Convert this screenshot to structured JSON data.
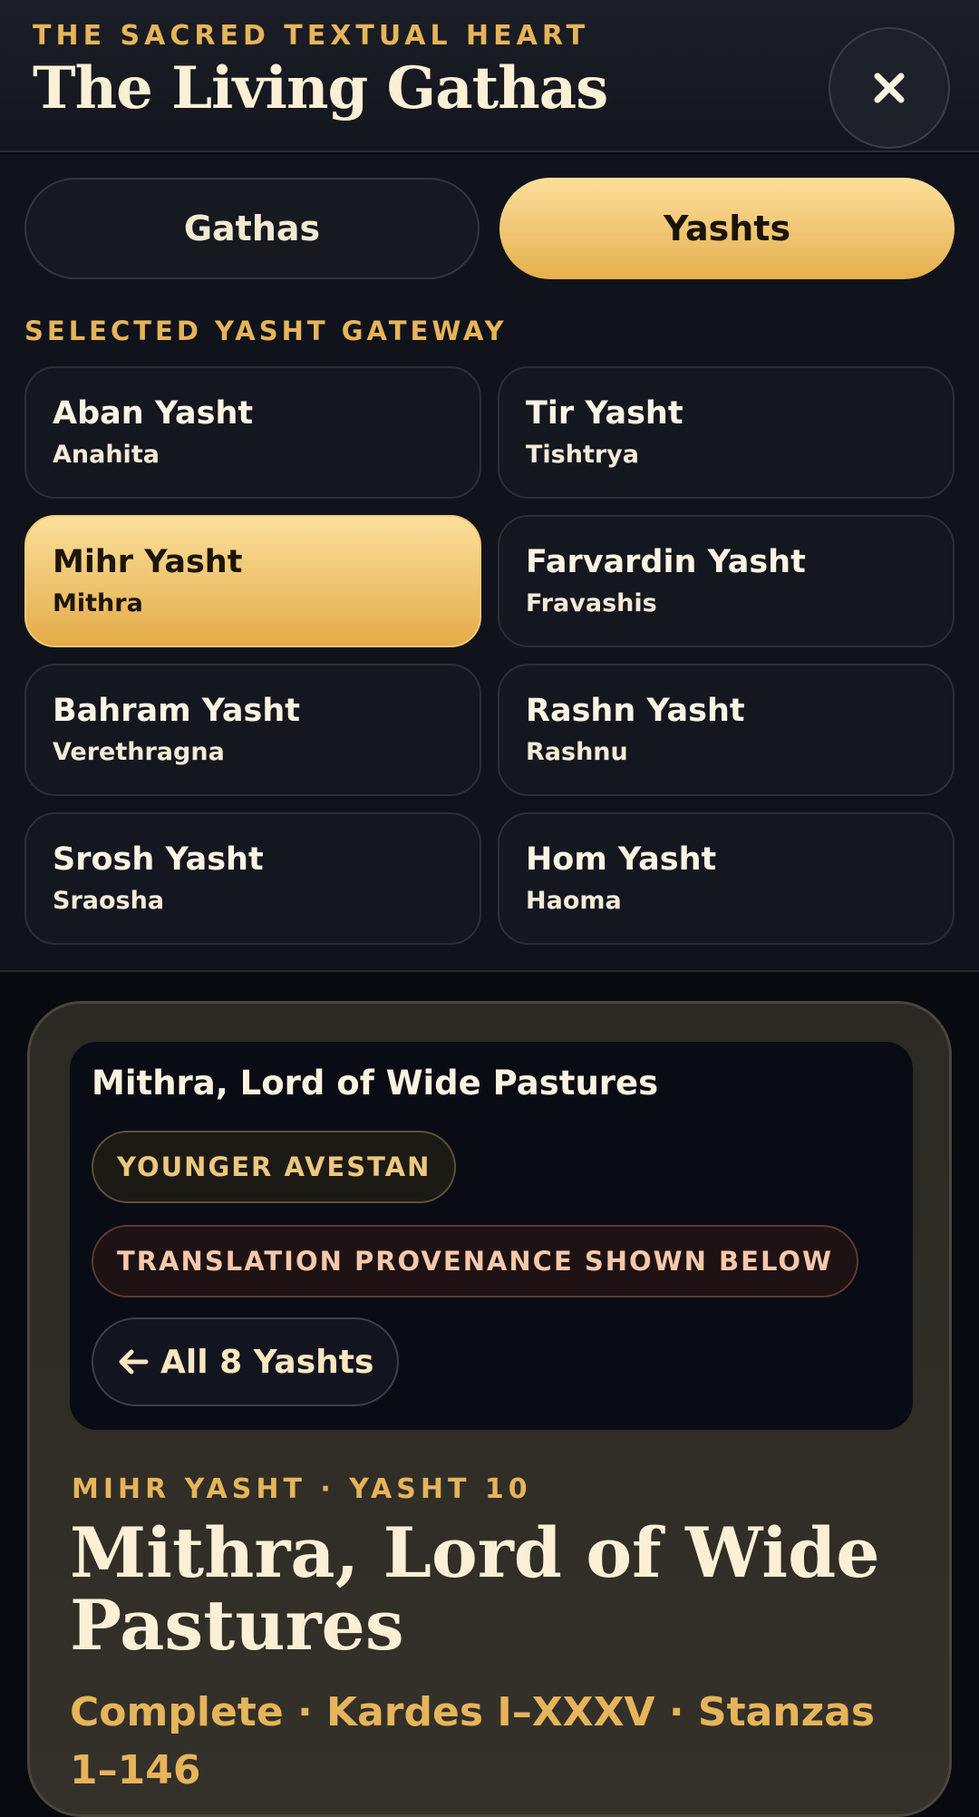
{
  "header": {
    "eyebrow": "THE SACRED TEXTUAL HEART",
    "title": "The Living Gathas",
    "close_icon": "close-icon"
  },
  "tabs": [
    {
      "label": "Gathas",
      "selected": false
    },
    {
      "label": "Yashts",
      "selected": true
    }
  ],
  "gateway": {
    "label": "SELECTED YASHT GATEWAY",
    "items": [
      {
        "name": "Aban Yasht",
        "deity": "Anahita",
        "selected": false
      },
      {
        "name": "Tir Yasht",
        "deity": "Tishtrya",
        "selected": false
      },
      {
        "name": "Mihr Yasht",
        "deity": "Mithra",
        "selected": true
      },
      {
        "name": "Farvardin Yasht",
        "deity": "Fravashis",
        "selected": false
      },
      {
        "name": "Bahram Yasht",
        "deity": "Verethragna",
        "selected": false
      },
      {
        "name": "Rashn Yasht",
        "deity": "Rashnu",
        "selected": false
      },
      {
        "name": "Srosh Yasht",
        "deity": "Sraosha",
        "selected": false
      },
      {
        "name": "Hom Yasht",
        "deity": "Haoma",
        "selected": false
      }
    ]
  },
  "detail": {
    "card_title": "Mithra, Lord of Wide Pastures",
    "badge_era": "YOUNGER AVESTAN",
    "badge_provenance": "TRANSLATION PROVENANCE SHOWN BELOW",
    "back_label": "All 8 Yashts",
    "back_icon": "arrow-left-icon",
    "kicker": "MIHR YASHT · YASHT 10",
    "title": "Mithra, Lord of Wide Pastures",
    "scope": "Complete · Kardes I–XXXV · Stanzas 1–146"
  },
  "colors": {
    "accent_gold": "#e6b45a",
    "gold_light": "#fbdf9c",
    "background": "#080a10",
    "text_cream": "#fbf0d5"
  }
}
